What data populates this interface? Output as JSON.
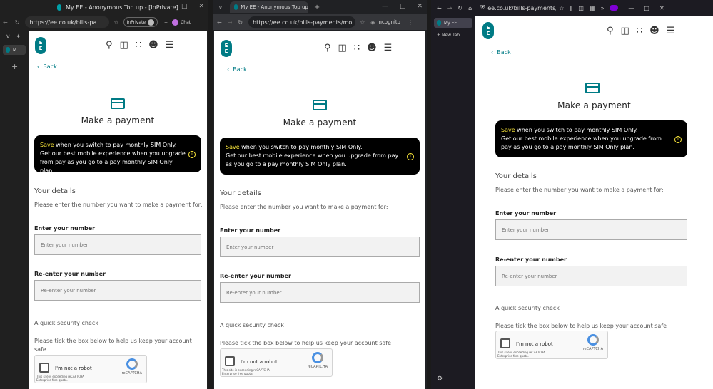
{
  "windows": {
    "edge": {
      "title": "My EE - Anonymous Top up - [InPrivate]",
      "url": "https://ee.co.uk/bills-pa...",
      "inprivate_label": "InPrivate",
      "chat_label": "Chat",
      "tab_label": "M"
    },
    "chrome": {
      "tab_title": "My EE - Anonymous Top up",
      "url": "https://ee.co.uk/bills-payments/mo...",
      "incognito_label": "Incognito"
    },
    "firefox": {
      "url": "ee.co.uk/bills-payments/mob",
      "tab_title": "My EE",
      "new_tab_label": "New Tab"
    }
  },
  "page": {
    "logo_top": "E",
    "logo_bottom": "E",
    "back_label": "Back",
    "title": "Make a payment",
    "promo_save": "Save",
    "promo_headline_rest": " when you switch to pay monthly SIM Only.",
    "promo_body": "Get our best mobile experience when you upgrade from pay as you go to a pay monthly SIM Only plan.",
    "details_heading": "Your details",
    "details_sub": "Please enter the number you want to make a payment for:",
    "number_label": "Enter your number",
    "number_placeholder": "Enter your number",
    "renumber_label": "Re-enter your number",
    "renumber_placeholder": "Re-enter your number",
    "security_heading": "A quick security check",
    "security_sub": "Please tick the box below to help us keep your account safe",
    "captcha_label": "I'm not a robot",
    "captcha_brand": "reCAPTCHA",
    "captcha_note": "This site is exceeding reCAPTCHA Enterprise free quota."
  },
  "colors": {
    "brand": "#007b85",
    "promo_bg": "#000000",
    "promo_accent": "#ffeb3b"
  }
}
